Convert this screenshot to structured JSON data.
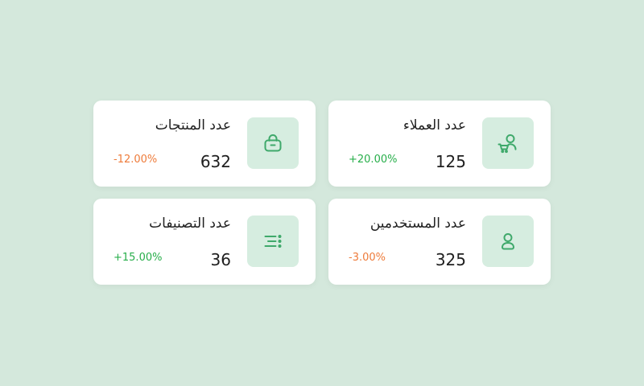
{
  "colors": {
    "background": "#d4e8dc",
    "card": "#ffffff",
    "icon_bg": "#d6ede0",
    "icon_stroke": "#3fa96b",
    "positive": "#27ae4a",
    "negative": "#ee7b3a"
  },
  "cards": [
    {
      "title": "عدد المنتجات",
      "value": "632",
      "change": "-12.00%",
      "trend": "down",
      "icon": "shopping-bag-icon"
    },
    {
      "title": "عدد العملاء",
      "value": "125",
      "change": "+20.00%",
      "trend": "up",
      "icon": "customer-cart-icon"
    },
    {
      "title": "عدد التصنيفات",
      "value": "36",
      "change": "+15.00%",
      "trend": "up",
      "icon": "categories-list-icon"
    },
    {
      "title": "عدد المستخدمين",
      "value": "325",
      "change": "-3.00%",
      "trend": "down",
      "icon": "user-icon"
    }
  ]
}
